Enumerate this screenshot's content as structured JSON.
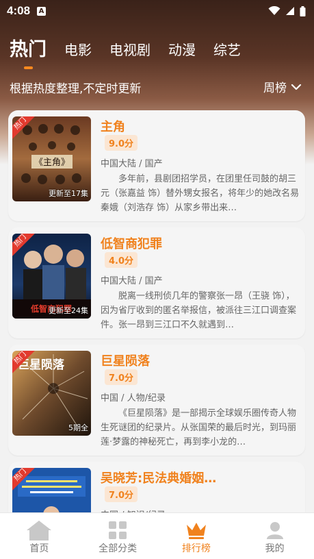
{
  "status_bar": {
    "time": "4:08",
    "notification_icon": "A"
  },
  "tabs": [
    {
      "label": "热门",
      "active": true
    },
    {
      "label": "电影",
      "active": false
    },
    {
      "label": "电视剧",
      "active": false
    },
    {
      "label": "动漫",
      "active": false
    },
    {
      "label": "综艺",
      "active": false
    }
  ],
  "subtitle": "根据热度整理,不定时更新",
  "ranking_selector": "周榜",
  "items": [
    {
      "tag": "热门",
      "poster_note": "更新至17集",
      "title": "主角",
      "score": "9.0分",
      "meta": "中国大陆 / 国产",
      "desc": "多年前，县剧团招学员，在团里任司鼓的胡三元（张嘉益 饰）替外甥女报名，将年少的她改名易秦娥（刘浩存 饰）从家乡带出来…"
    },
    {
      "tag": "热门",
      "poster_note": "更新至24集",
      "title": "低智商犯罪",
      "score": "4.0分",
      "meta": "中国大陆 / 国产",
      "desc": "脱离一线刑侦几年的警察张一昂（王骁 饰），因为省厅收到的匿名举报信，被派往三江口调查案件。张一昂到三江口不久就遇到…"
    },
    {
      "tag": "热门",
      "poster_note": "5期全",
      "title": "巨星陨落",
      "score": "7.0分",
      "meta": "中国 / 人物/纪录",
      "desc": "《巨星陨落》是一部揭示全球娱乐圈传奇人物生死谜团的纪录片。从张国荣的最后时光，到玛丽莲·梦露的神秘死亡，再到李小龙的…"
    },
    {
      "tag": "热门",
      "poster_note": "",
      "title": "吴晓芳:民法典婚姻…",
      "score": "7.0分",
      "meta": "中国 / 知识/纪录",
      "desc": ""
    }
  ],
  "bottom_nav": [
    {
      "label": "首页",
      "icon": "home-icon"
    },
    {
      "label": "全部分类",
      "icon": "grid-icon"
    },
    {
      "label": "排行榜",
      "icon": "crown-icon",
      "active": true
    },
    {
      "label": "我的",
      "icon": "user-icon"
    }
  ],
  "colors": {
    "accent": "#f0821e",
    "tag_red": "#e23a2e",
    "header_dark": "#3a2219"
  }
}
